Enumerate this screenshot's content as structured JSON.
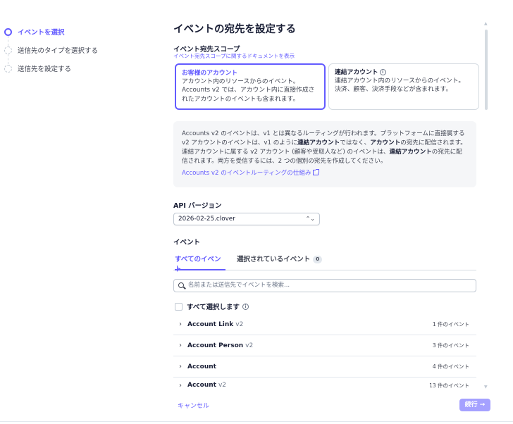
{
  "steps": [
    {
      "label": "イベントを選択",
      "state": "active"
    },
    {
      "label": "送信先のタイプを選択する",
      "state": "pending"
    },
    {
      "label": "送信先を設定する",
      "state": "pending"
    }
  ],
  "page": {
    "title": "イベントの宛先を設定する"
  },
  "scope": {
    "title": "イベント宛先スコープ",
    "doc_link": "イベント宛先スコープに関するドキュメントを表示",
    "options": [
      {
        "title": "お客様のアカウント",
        "line1": "アカウント内のリソースからのイベント。",
        "line2": "Accounts v2 では、アカウント内に直接作成さ",
        "line3": "れたアカウントのイベントも含まれます。",
        "selected": true
      },
      {
        "title": "連結アカウント",
        "line1": "連結アカウント内のリソースからのイベント。",
        "line2": "決済、顧客、決済手段などが含まれます。",
        "selected": false
      }
    ]
  },
  "notice": {
    "t1": "Accounts v2 のイベントは、v1 とは異なるルーティングが行われます。プラットフォームに直接属",
    "t2": "する v2 アカウントのイベントは、v1 のように",
    "b1": "連結アカウント",
    "t3": "ではなく、",
    "b2": "アカウント",
    "t4": "の宛先に配",
    "t5": "信されます。連結アカウントに属する v2 アカウント (顧客や受取人など) のイベントは、",
    "b3": "連結アカ",
    "b4": "ウント",
    "t6": "の宛先に配信されます。両方を受信するには、2 つの個別の宛先を作成してください。",
    "link": "Accounts v2 のイベントルーティングの仕組み"
  },
  "api": {
    "label": "API バージョン",
    "value": "2026-02-25.clover"
  },
  "events": {
    "label": "イベント",
    "tabs": [
      {
        "label": "すべてのイベント"
      },
      {
        "label": "選択されているイベント",
        "badge": "0"
      }
    ],
    "search_placeholder": "名前または送信先でイベントを検索...",
    "select_all": "すべて選択します",
    "rows": [
      {
        "name": "Account Link",
        "version": "v2",
        "count": "1 件のイベント"
      },
      {
        "name": "Account Person",
        "version": "v2",
        "count": "3 件のイベント"
      },
      {
        "name": "Account",
        "version": "",
        "count": "4 件のイベント"
      },
      {
        "name": "Account",
        "version": "v2",
        "count": "13 件のイベント"
      }
    ]
  },
  "footer": {
    "cancel": "キャンセル",
    "continue": "続行 →"
  },
  "colors": {
    "accent": "#635bff",
    "continue_disabled": "#a5a1ff"
  }
}
